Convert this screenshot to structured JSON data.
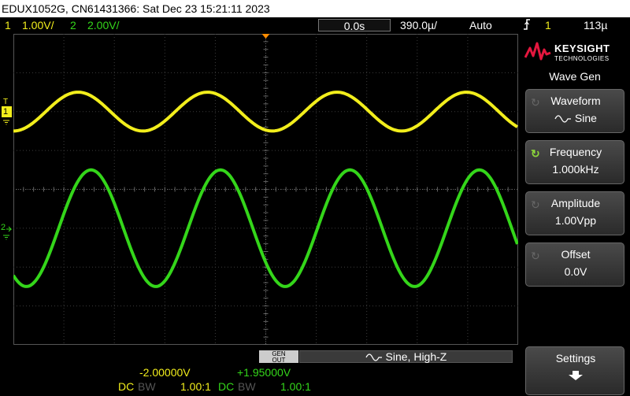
{
  "title_bar": {
    "text": "EDUX1052G, CN61431366: Sat Dec 23 15:21:11 2023"
  },
  "status": {
    "ch1_num": "1",
    "ch1_scale": "1.00V/",
    "ch2_num": "2",
    "ch2_scale": "2.00V/",
    "time_offset": "0.0s",
    "time_scale": "390.0µ/",
    "trigger_mode": "Auto",
    "trigger_icon": "rising-edge-icon",
    "trigger_source": "1",
    "trigger_level": "113µ"
  },
  "left_markers": {
    "trigger_level_marker": "T",
    "ch1_marker": "1",
    "ch2_marker": "2"
  },
  "brand": {
    "name": "KEYSIGHT",
    "sub": "TECHNOLOGIES",
    "accent": "#e4173e"
  },
  "panel": {
    "title": "Wave Gen",
    "softkeys": [
      {
        "label": "Waveform",
        "value": "Sine",
        "value_icon": "sine-icon",
        "active": false
      },
      {
        "label": "Frequency",
        "value": "1.000kHz",
        "active": true
      },
      {
        "label": "Amplitude",
        "value": "1.00Vpp",
        "active": false
      },
      {
        "label": "Offset",
        "value": "0.0V",
        "active": false
      }
    ],
    "settings": {
      "label": "Settings",
      "icon": "down-arrow-icon"
    }
  },
  "wavegen": {
    "badge_top": "GEN",
    "badge_bottom": "OUT",
    "info": "Sine, High-Z",
    "icon": "sine-icon"
  },
  "channel_readout": {
    "ch1": {
      "offset": "-2.00000V",
      "coupling": "DC",
      "bw": "BW",
      "probe": "1.00:1"
    },
    "ch2": {
      "offset": "+1.95000V",
      "coupling": "DC",
      "bw": "BW",
      "probe": "1.00:1"
    }
  },
  "colors": {
    "ch1": "#f2ee1c",
    "ch2": "#34d61a",
    "grid": "#3c3c3c",
    "active": "#8cd63a"
  },
  "chart_data": {
    "type": "line",
    "series": [
      {
        "name": "1",
        "waveform": "sine",
        "cycles_on_screen": 3.9,
        "amplitude_divs": 0.5,
        "center_div_from_top": 2.0
      },
      {
        "name": "2",
        "waveform": "sine",
        "cycles_on_screen": 3.9,
        "amplitude_divs": 1.5,
        "center_div_from_top": 5.0
      }
    ],
    "grid_divisions": {
      "x": 10,
      "y": 8
    },
    "grid": true
  }
}
